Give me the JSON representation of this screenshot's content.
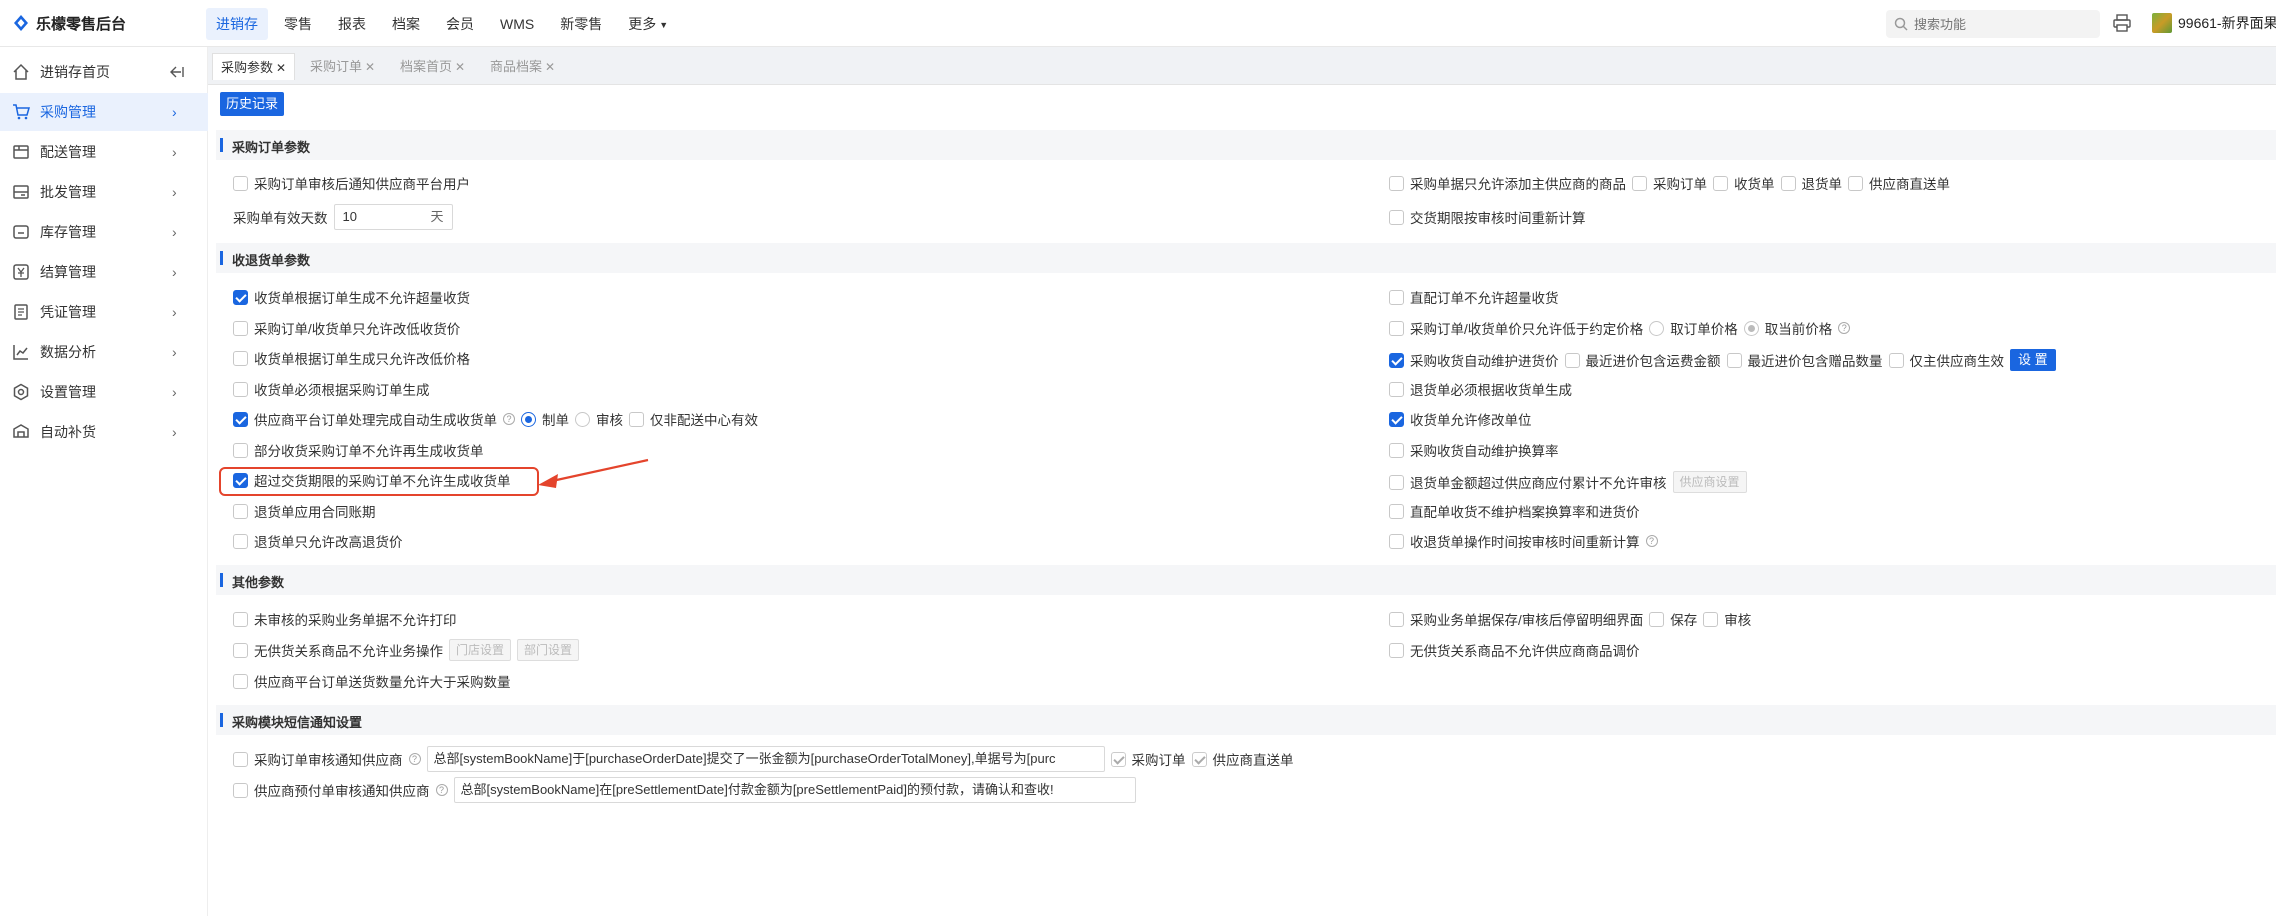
{
  "app": {
    "brand_name": "乐檬零售后台",
    "top_nav": [
      {
        "label": "进销存",
        "active": true
      },
      {
        "label": "零售"
      },
      {
        "label": "报表"
      },
      {
        "label": "档案"
      },
      {
        "label": "会员"
      },
      {
        "label": "WMS"
      },
      {
        "label": "新零售"
      },
      {
        "label": "更多"
      }
    ],
    "search_placeholder": "搜索功能",
    "user_name": "99661-新界面果",
    "accent_color": "#1a66e0"
  },
  "sidebar": {
    "items": [
      {
        "label": "进销存首页",
        "icon": "home-icon"
      },
      {
        "label": "采购管理",
        "icon": "cart-icon",
        "active": true
      },
      {
        "label": "配送管理",
        "icon": "truck-icon"
      },
      {
        "label": "批发管理",
        "icon": "box-icon"
      },
      {
        "label": "库存管理",
        "icon": "inventory-icon"
      },
      {
        "label": "结算管理",
        "icon": "yen-icon"
      },
      {
        "label": "凭证管理",
        "icon": "document-icon"
      },
      {
        "label": "数据分析",
        "icon": "chart-icon"
      },
      {
        "label": "设置管理",
        "icon": "gear-icon"
      },
      {
        "label": "自动补货",
        "icon": "replenish-icon"
      }
    ]
  },
  "tabs": [
    {
      "label": "采购参数",
      "active": true
    },
    {
      "label": "采购订单"
    },
    {
      "label": "档案首页"
    },
    {
      "label": "商品档案"
    }
  ],
  "history_button": "历史记录",
  "sections": {
    "order_params": {
      "title": "采购订单参数",
      "notify_supplier": "采购订单审核后通知供应商平台用户",
      "valid_days_label": "采购单有效天数",
      "valid_days_value": "10",
      "valid_days_unit": "天",
      "main_supplier_only": "采购单据只允许添加主供应商的商品",
      "doc_order": "采购订单",
      "doc_receive": "收货单",
      "doc_return": "退货单",
      "doc_direct": "供应商直送单",
      "recalc_delivery": "交货期限按审核时间重新计算"
    },
    "receive_params": {
      "title": "收退货单参数",
      "left": [
        {
          "label": "收货单根据订单生成不允许超量收货",
          "checked": true
        },
        {
          "label": "采购订单/收货单只允许改低收货价",
          "checked": false
        },
        {
          "label": "收货单根据订单生成只允许改低价格",
          "checked": false
        },
        {
          "label": "收货单必须根据采购订单生成",
          "checked": false
        },
        {
          "label": "供应商平台订单处理完成自动生成收货单",
          "checked": true
        },
        {
          "label": "部分收货采购订单不允许再生成收货单",
          "checked": false
        },
        {
          "label": "超过交货期限的采购订单不允许生成收货单",
          "checked": true
        },
        {
          "label": "退货单应用合同账期",
          "checked": false
        },
        {
          "label": "退货单只允许改高退货价",
          "checked": false
        }
      ],
      "auto_opt_draft": "制单",
      "auto_opt_audit": "审核",
      "auto_opt_nondc": "仅非配送中心有效",
      "right": [
        {
          "label": "直配订单不允许超量收货",
          "checked": false
        },
        {
          "label": "采购订单/收货单价只允许低于约定价格",
          "checked": false
        },
        {
          "label": "采购收货自动维护进货价",
          "checked": true
        },
        {
          "label": "退货单必须根据收货单生成",
          "checked": false
        },
        {
          "label": "收货单允许修改单位",
          "checked": true
        },
        {
          "label": "采购收货自动维护换算率",
          "checked": false
        },
        {
          "label": "退货单金额超过供应商应付累计不允许审核",
          "checked": false
        },
        {
          "label": "直配单收货不维护档案换算率和进货价",
          "checked": false
        },
        {
          "label": "收退货单操作时间按审核时间重新计算",
          "checked": false
        }
      ],
      "price_opt_order": "取订单价格",
      "price_opt_current": "取当前价格",
      "maintain_freight": "最近进价包含运费金额",
      "maintain_gift": "最近进价包含赠品数量",
      "maintain_main_only": "仅主供应商生效",
      "settings_button": "设 置",
      "supplier_settings_button": "供应商设置"
    },
    "other_params": {
      "title": "其他参数",
      "left": [
        {
          "label": "未审核的采购业务单据不允许打印"
        },
        {
          "label": "无供货关系商品不允许业务操作"
        },
        {
          "label": "供应商平台订单送货数量允许大于采购数量"
        }
      ],
      "store_settings": "门店设置",
      "dept_settings": "部门设置",
      "right": [
        {
          "label": "采购业务单据保存/审核后停留明细界面"
        },
        {
          "label": "无供货关系商品不允许供应商商品调价"
        }
      ],
      "opt_save": "保存",
      "opt_audit": "审核"
    },
    "sms_params": {
      "title": "采购模块短信通知设置",
      "order_notify_label": "采购订单审核通知供应商",
      "order_notify_template": "总部[systemBookName]于[purchaseOrderDate]提交了一张金额为[purchaseOrderTotalMoney],单据号为[purc",
      "order_notify_opt1": "采购订单",
      "order_notify_opt2": "供应商直送单",
      "prepay_notify_label": "供应商预付单审核通知供应商",
      "prepay_notify_template": "总部[systemBookName]在[preSettlementDate]付款金额为[preSettlementPaid]的预付款，请确认和查收!"
    }
  }
}
